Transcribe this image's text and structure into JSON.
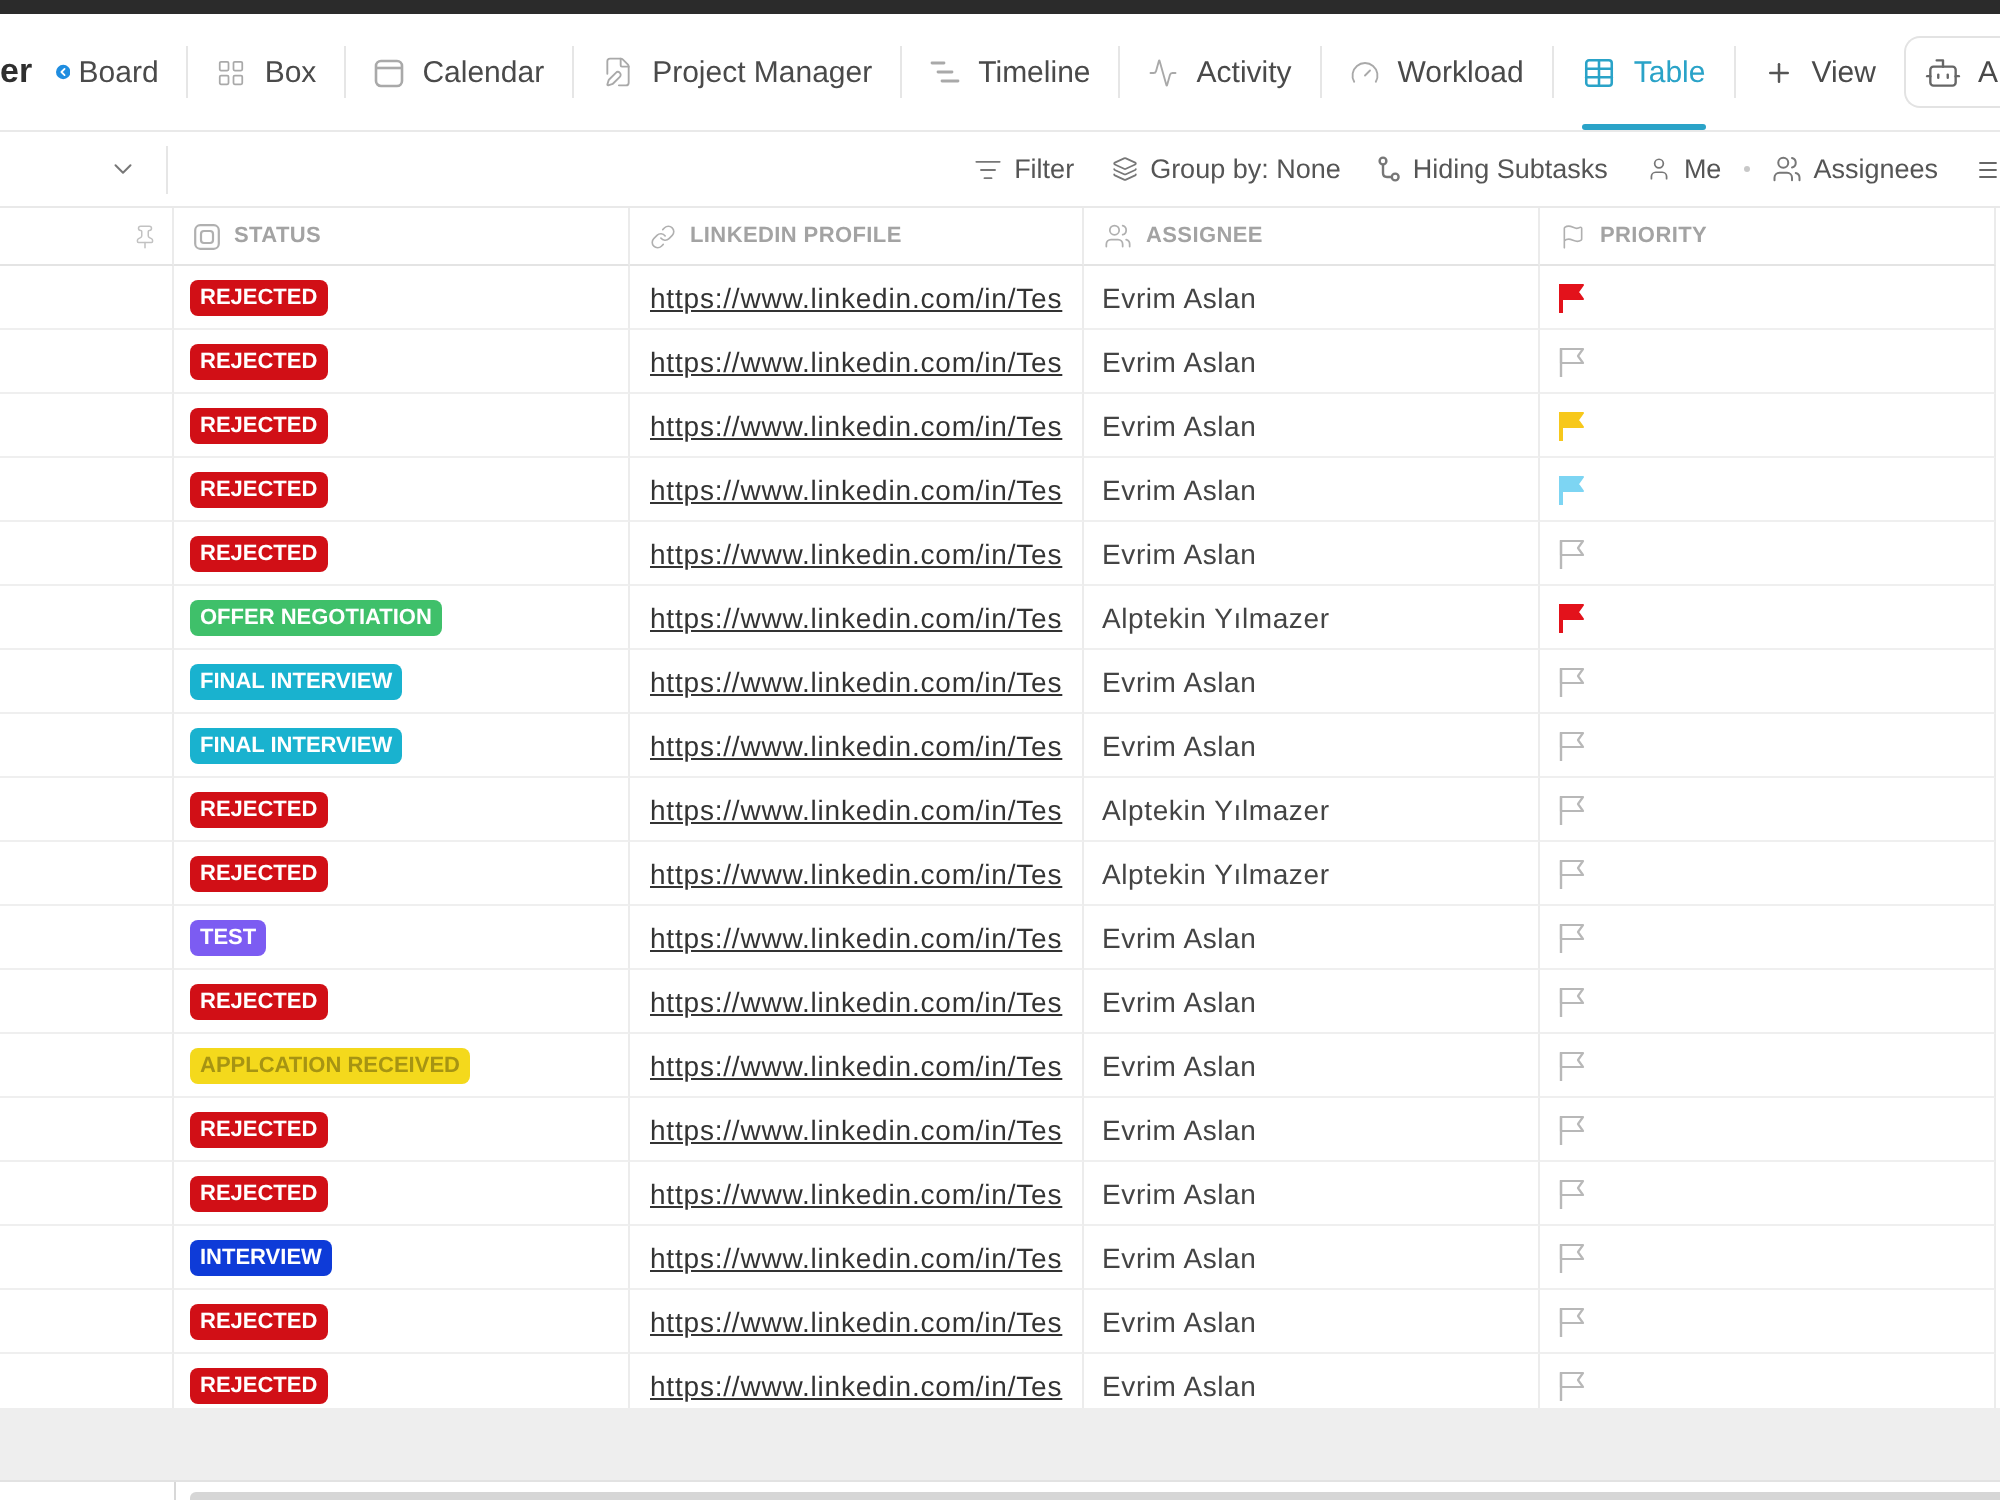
{
  "title": "er",
  "tabs": [
    {
      "label": "Board",
      "selected": false
    },
    {
      "label": "Box",
      "selected": false
    },
    {
      "label": "Calendar",
      "selected": false
    },
    {
      "label": "Project Manager",
      "selected": false
    },
    {
      "label": "Timeline",
      "selected": false
    },
    {
      "label": "Activity",
      "selected": false
    },
    {
      "label": "Workload",
      "selected": false
    },
    {
      "label": "Table",
      "selected": true
    }
  ],
  "add_view": {
    "label": "View"
  },
  "robot_button": {
    "label": "A"
  },
  "toolbar": {
    "items": [
      {
        "label": "Filter"
      },
      {
        "label": "Group by: None"
      },
      {
        "label": "Hiding Subtasks"
      },
      {
        "label": "Me"
      },
      {
        "label": "Assignees"
      }
    ]
  },
  "table": {
    "columns": [
      {
        "label": "STATUS"
      },
      {
        "label": "LINKEDIN PROFILE"
      },
      {
        "label": "ASSIGNEE"
      },
      {
        "label": "PRIORITY"
      }
    ],
    "rows": [
      {
        "status": {
          "label": "REJECTED",
          "color": "#d10f16"
        },
        "linkedin": "https://www.linkedin.com/in/Tes",
        "assignee": "Evrim Aslan",
        "priority": {
          "filled": true,
          "color": "#e3121b"
        }
      },
      {
        "status": {
          "label": "REJECTED",
          "color": "#d10f16"
        },
        "linkedin": "https://www.linkedin.com/in/Tes",
        "assignee": "Evrim Aslan",
        "priority": {
          "filled": false
        }
      },
      {
        "status": {
          "label": "REJECTED",
          "color": "#d10f16"
        },
        "linkedin": "https://www.linkedin.com/in/Tes",
        "assignee": "Evrim Aslan",
        "priority": {
          "filled": true,
          "color": "#f7c81b"
        }
      },
      {
        "status": {
          "label": "REJECTED",
          "color": "#d10f16"
        },
        "linkedin": "https://www.linkedin.com/in/Tes",
        "assignee": "Evrim Aslan",
        "priority": {
          "filled": true,
          "color": "#7dd5f3"
        }
      },
      {
        "status": {
          "label": "REJECTED",
          "color": "#d10f16"
        },
        "linkedin": "https://www.linkedin.com/in/Tes",
        "assignee": "Evrim Aslan",
        "priority": {
          "filled": false
        }
      },
      {
        "status": {
          "label": "OFFER NEGOTIATION",
          "color": "#3fc06a"
        },
        "linkedin": "https://www.linkedin.com/in/Tes",
        "assignee": "Alptekin Yılmazer",
        "priority": {
          "filled": true,
          "color": "#e3121b"
        }
      },
      {
        "status": {
          "label": "FINAL INTERVIEW",
          "color": "#19b2cf"
        },
        "linkedin": "https://www.linkedin.com/in/Tes",
        "assignee": "Evrim Aslan",
        "priority": {
          "filled": false
        }
      },
      {
        "status": {
          "label": "FINAL INTERVIEW",
          "color": "#19b2cf"
        },
        "linkedin": "https://www.linkedin.com/in/Tes",
        "assignee": "Evrim Aslan",
        "priority": {
          "filled": false
        }
      },
      {
        "status": {
          "label": "REJECTED",
          "color": "#d10f16"
        },
        "linkedin": "https://www.linkedin.com/in/Tes",
        "assignee": "Alptekin Yılmazer",
        "priority": {
          "filled": false
        }
      },
      {
        "status": {
          "label": "REJECTED",
          "color": "#d10f16"
        },
        "linkedin": "https://www.linkedin.com/in/Tes",
        "assignee": "Alptekin Yılmazer",
        "priority": {
          "filled": false
        }
      },
      {
        "status": {
          "label": "TEST",
          "color": "#7c5cf2"
        },
        "linkedin": "https://www.linkedin.com/in/Tes",
        "assignee": "Evrim Aslan",
        "priority": {
          "filled": false
        }
      },
      {
        "status": {
          "label": "REJECTED",
          "color": "#d10f16"
        },
        "linkedin": "https://www.linkedin.com/in/Tes",
        "assignee": "Evrim Aslan",
        "priority": {
          "filled": false
        }
      },
      {
        "status": {
          "label": "APPLCATION RECEIVED",
          "color": "#f4d91c"
        },
        "linkedin": "https://www.linkedin.com/in/Tes",
        "assignee": "Evrim Aslan",
        "priority": {
          "filled": false
        }
      },
      {
        "status": {
          "label": "REJECTED",
          "color": "#d10f16"
        },
        "linkedin": "https://www.linkedin.com/in/Tes",
        "assignee": "Evrim Aslan",
        "priority": {
          "filled": false
        }
      },
      {
        "status": {
          "label": "REJECTED",
          "color": "#d10f16"
        },
        "linkedin": "https://www.linkedin.com/in/Tes",
        "assignee": "Evrim Aslan",
        "priority": {
          "filled": false
        }
      },
      {
        "status": {
          "label": "INTERVIEW",
          "color": "#0e3bd8"
        },
        "linkedin": "https://www.linkedin.com/in/Tes",
        "assignee": "Evrim Aslan",
        "priority": {
          "filled": false
        }
      },
      {
        "status": {
          "label": "REJECTED",
          "color": "#d10f16"
        },
        "linkedin": "https://www.linkedin.com/in/Tes",
        "assignee": "Evrim Aslan",
        "priority": {
          "filled": false
        }
      },
      {
        "status": {
          "label": "REJECTED",
          "color": "#d10f16"
        },
        "linkedin": "https://www.linkedin.com/in/Tes",
        "assignee": "Evrim Aslan",
        "priority": {
          "filled": false
        }
      }
    ]
  }
}
